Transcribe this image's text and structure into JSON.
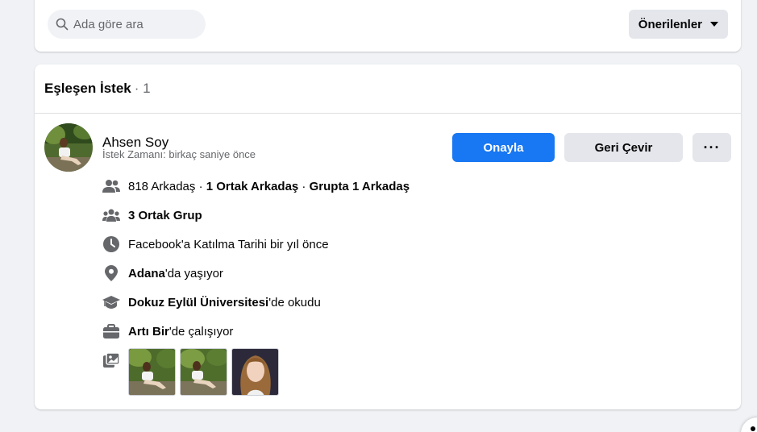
{
  "search": {
    "placeholder": "Ada göre ara",
    "icon": "search-icon"
  },
  "sort": {
    "label": "Önerilenler",
    "icon": "caret-down-icon"
  },
  "section": {
    "title": "Eşleşen İstek",
    "count": "· 1"
  },
  "request": {
    "name": "Ahsen Soy",
    "time": "İstek Zamanı: birkaç saniye önce",
    "confirm_label": "Onayla",
    "decline_label": "Geri Çevir",
    "more_label": "···"
  },
  "info": {
    "friends": {
      "count": "818 Arkadaş",
      "sep1": " · ",
      "mutual": "1 Ortak Arkadaş",
      "sep2": " · ",
      "group_friends": "Grupta 1 Arkadaş",
      "icon": "friends-icon"
    },
    "groups": {
      "text": "3 Ortak Grup",
      "icon": "groups-icon"
    },
    "joined": {
      "text": "Facebook'a Katılma Tarihi bir yıl önce",
      "icon": "clock-icon"
    },
    "lives": {
      "place": "Adana",
      "suffix": "'da yaşıyor",
      "icon": "location-pin-icon"
    },
    "studied": {
      "school": "Dokuz Eylül Üniversitesi",
      "suffix": "'de okudu",
      "icon": "graduation-cap-icon"
    },
    "works": {
      "company": "Artı Bir",
      "suffix": "'de çalışıyor",
      "icon": "briefcase-icon"
    },
    "photos": {
      "icon": "photos-icon",
      "count": 3
    }
  },
  "colors": {
    "primary": "#1877f2",
    "secondary_btn": "#e4e6eb",
    "muted_text": "#65676b",
    "background": "#f0f2f5"
  }
}
